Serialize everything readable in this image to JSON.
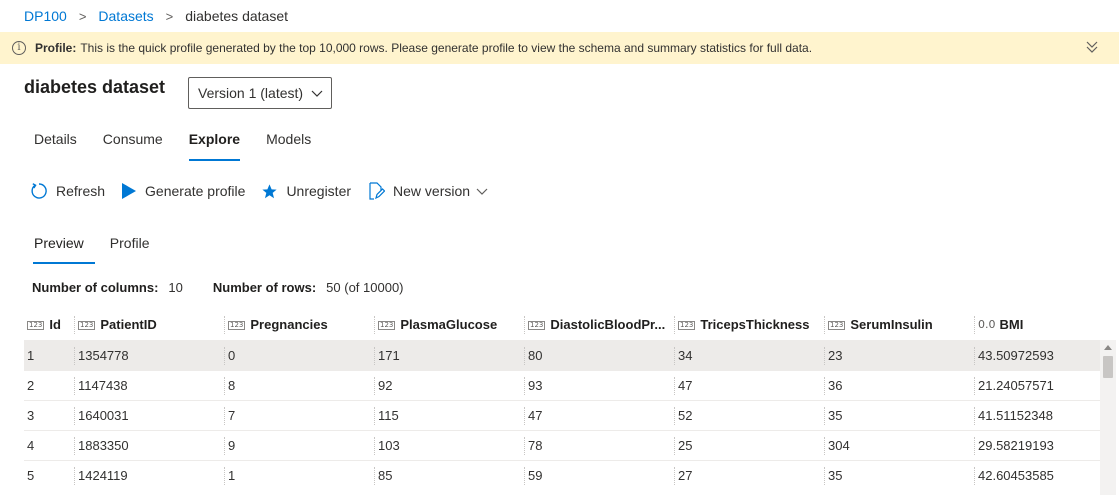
{
  "breadcrumb": {
    "items": [
      "DP100",
      "Datasets"
    ],
    "current": "diabetes dataset",
    "separator": ">"
  },
  "banner": {
    "bold": "Profile:",
    "text": "This is the quick profile generated by the top 10,000 rows. Please generate profile to view the schema and summary statistics for full data.",
    "info_glyph": "i",
    "icon": "info-icon",
    "expand_icon": "chevron-double-down-icon",
    "color": "#fff4ce"
  },
  "page": {
    "title": "diabetes dataset",
    "version": "Version 1 (latest)"
  },
  "tabs": [
    {
      "label": "Details",
      "active": false
    },
    {
      "label": "Consume",
      "active": false
    },
    {
      "label": "Explore",
      "active": true
    },
    {
      "label": "Models",
      "active": false
    }
  ],
  "toolbar": {
    "refresh": "Refresh",
    "generate_profile": "Generate profile",
    "unregister": "Unregister",
    "new_version": "New version"
  },
  "subtabs": [
    {
      "label": "Preview",
      "active": true
    },
    {
      "label": "Profile",
      "active": false
    }
  ],
  "counts": {
    "columns_label": "Number of columns:",
    "columns_value": "10",
    "rows_label": "Number of rows:",
    "rows_value": "50 (of 10000)"
  },
  "grid": {
    "type_int_glyph": "123",
    "type_dec_glyph": "0.0",
    "columns": [
      {
        "name": "Id",
        "type": "int"
      },
      {
        "name": "PatientID",
        "type": "int"
      },
      {
        "name": "Pregnancies",
        "type": "int"
      },
      {
        "name": "PlasmaGlucose",
        "type": "int"
      },
      {
        "name": "DiastolicBloodPr...",
        "type": "int"
      },
      {
        "name": "TricepsThickness",
        "type": "int"
      },
      {
        "name": "SerumInsulin",
        "type": "int"
      },
      {
        "name": "BMI",
        "type": "decimal"
      }
    ],
    "rows": [
      [
        "1",
        "1354778",
        "0",
        "171",
        "80",
        "34",
        "23",
        "43.50972593"
      ],
      [
        "2",
        "1147438",
        "8",
        "92",
        "93",
        "47",
        "36",
        "21.24057571"
      ],
      [
        "3",
        "1640031",
        "7",
        "115",
        "47",
        "52",
        "35",
        "41.51152348"
      ],
      [
        "4",
        "1883350",
        "9",
        "103",
        "78",
        "25",
        "304",
        "29.58219193"
      ],
      [
        "5",
        "1424119",
        "1",
        "85",
        "59",
        "27",
        "35",
        "42.60453585"
      ]
    ],
    "selected_row": 0,
    "accent": "#0078d4"
  }
}
